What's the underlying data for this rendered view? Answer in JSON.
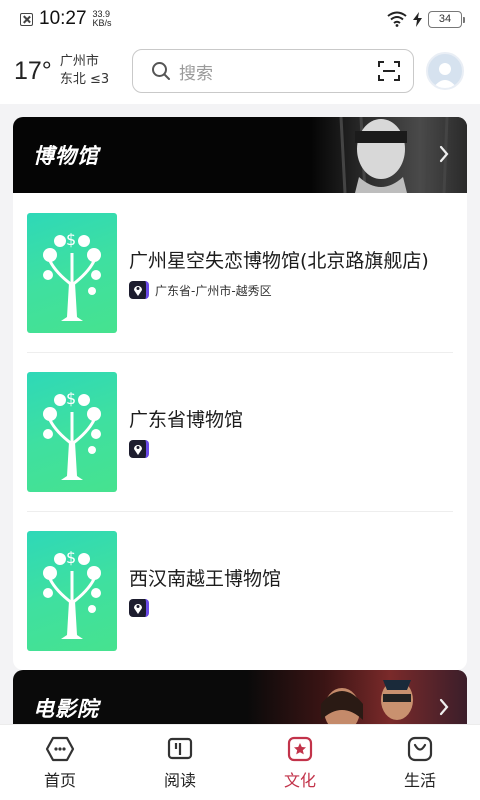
{
  "status_bar": {
    "time": "10:27",
    "speed_value": "33.9",
    "speed_unit": "KB/s",
    "battery": "34"
  },
  "header": {
    "temperature": "17°",
    "city": "广州市",
    "wind": "东北 ≤3",
    "search_placeholder": "搜索"
  },
  "sections": {
    "museum": {
      "title": "博物馆",
      "items": [
        {
          "name": "广州星空失恋博物馆(北京路旗舰店)",
          "location": "广东省-广州市-越秀区"
        },
        {
          "name": "广东省博物馆",
          "location": ""
        },
        {
          "name": "西汉南越王博物馆",
          "location": ""
        }
      ]
    },
    "cinema": {
      "title": "电影院"
    }
  },
  "bottom_nav": [
    {
      "label": "首页",
      "icon": "home-icon"
    },
    {
      "label": "阅读",
      "icon": "book-icon"
    },
    {
      "label": "文化",
      "icon": "culture-icon"
    },
    {
      "label": "生活",
      "icon": "life-icon"
    }
  ],
  "colors": {
    "accent": "#c2334a",
    "thumb_green": "#3fe0a0",
    "banner_black": "#050505"
  }
}
